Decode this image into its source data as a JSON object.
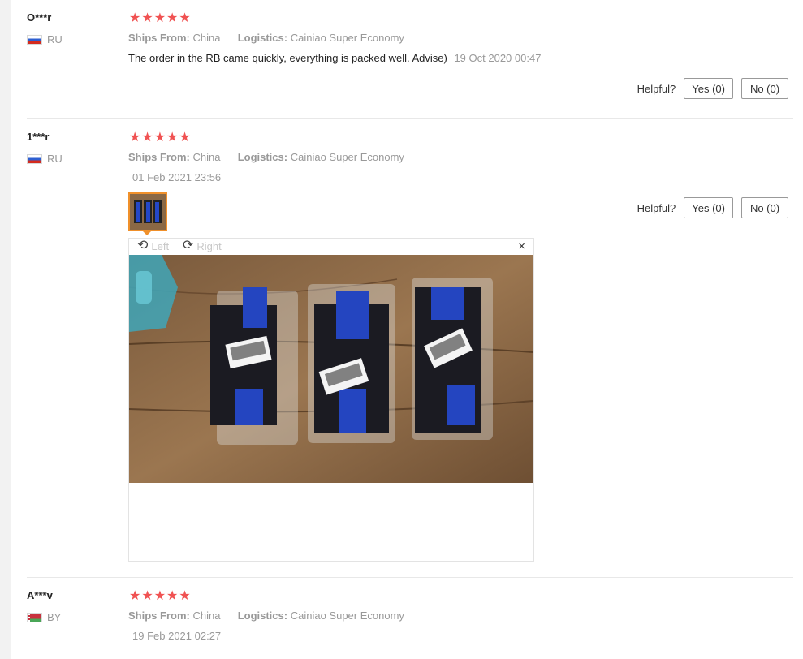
{
  "labels": {
    "ships_from": "Ships From:",
    "logistics": "Logistics:",
    "helpful": "Helpful?",
    "yes": "Yes (0)",
    "no": "No (0)"
  },
  "reviews": [
    {
      "author": "O***r",
      "country": "RU",
      "rating": 5,
      "stars": "★★★★★",
      "ships_from": "China",
      "logistics": "Cainiao Super Economy",
      "text": "The order in the RB came quickly, everything is packed well. Advise)",
      "date": "19 Oct 2020 00:47"
    },
    {
      "author": "1***r",
      "country": "RU",
      "rating": 5,
      "stars": "★★★★★",
      "ships_from": "China",
      "logistics": "Cainiao Super Economy",
      "date": "01 Feb 2021 23:56",
      "viewer": {
        "rotate_left": "Left",
        "rotate_right": "Right",
        "close": "×"
      }
    },
    {
      "author": "A***v",
      "country": "BY",
      "rating": 5,
      "stars": "★★★★★",
      "ships_from": "China",
      "logistics": "Cainiao Super Economy",
      "date": "19 Feb 2021 02:27"
    }
  ],
  "colors": {
    "star": "#f05252",
    "thumb_border": "#f0902a",
    "muted_text": "#999999"
  },
  "icons": {
    "rotate_left": "rotate-left-icon",
    "rotate_right": "rotate-right-icon",
    "close": "close-icon"
  }
}
